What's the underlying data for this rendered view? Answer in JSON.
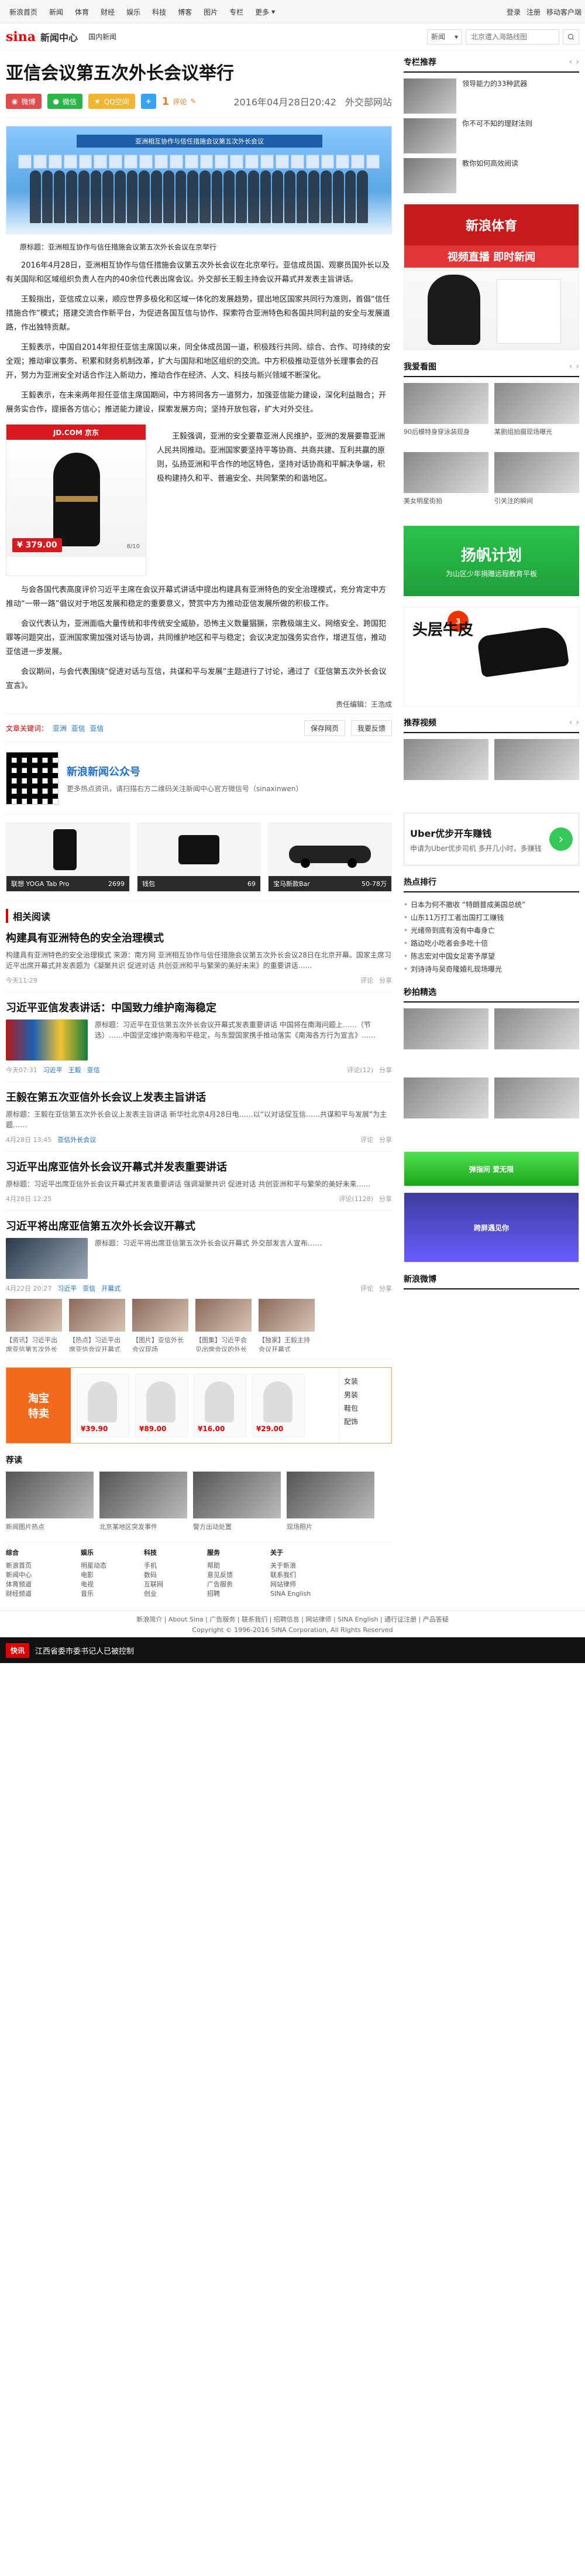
{
  "topbar": {
    "nav": [
      "新浪首页",
      "新闻",
      "体育",
      "财经",
      "娱乐",
      "科技",
      "博客",
      "图片",
      "专栏"
    ],
    "more": "更多",
    "right": [
      "登录",
      "注册",
      "移动客户端"
    ]
  },
  "header": {
    "logo_text": "sina",
    "section": "新闻中心",
    "breadcrumb": "国内新闻",
    "search": {
      "select_value": "新闻",
      "placeholder": "北京遭入海路线图"
    }
  },
  "article": {
    "title": "亚信会议第五次外长会议举行",
    "share": {
      "weibo": "微博",
      "weixin": "微信",
      "qzone": "QQ空间"
    },
    "comment_count": "1",
    "comment_label": "评论",
    "datetime": "2016年04月28日20:42",
    "source": "外交部网站",
    "hero_banner": "亚洲相互协作与信任措施会议第五次外长会议",
    "paragraphs": [
      "原标题：亚洲相互协作与信任措施会议第五次外长会议在京举行",
      "2016年4月28日，亚洲相互协作与信任措施会议第五次外长会议在北京举行。亚信成员国、观察员国外长以及有关国际和区域组织负责人在内的40余位代表出席会议。外交部长王毅主持会议开幕式并发表主旨讲话。",
      "王毅指出，亚信成立以来，顺应世界多极化和区域一体化的发展趋势，提出地区国家共同行为准则，首倡“信任措施合作”模式；搭建交流合作新平台，为促进各国互信与协作、探索符合亚洲特色和各国共同利益的安全与发展道路，作出独特贡献。",
      "王毅表示，中国自2014年担任亚信主席国以来，同全体成员国一道，积极践行共同、综合、合作、可持续的安全观；推动审议事务、积累和财务机制改革，扩大与国际和地区组织的交流。中方积极推动亚信外长理事会的召开，努力为亚洲安全对话合作注入新动力，推动合作在经济、人文、科技与新兴领域不断深化。",
      "王毅表示，在未来两年担任亚信主席国期间，中方将同各方一道努力，加强亚信能力建设，深化利益融合；开展务实合作，提振各方信心；推进能力建设，探索发展方向；坚持开放包容，扩大对外交往。",
      "王毅强调，亚洲的安全要靠亚洲人民维护，亚洲的发展要靠亚洲人民共同推动。亚洲国家要坚持平等协商、共商共建、互利共赢的原则，弘扬亚洲和平合作的地区特色，坚持对话协商和平解决争端，积极构建持久和平、普遍安全、共同繁荣的和谐地区。",
      "与会各国代表高度评价习近平主席在会议开幕式讲话中提出构建具有亚洲特色的安全治理模式，充分肯定中方推动“一带一路”倡议对于地区发展和稳定的重要意义，赞赏中方为推动亚信发展所做的积极工作。",
      "会议代表认为，亚洲面临大量传统和非传统安全威胁，恐怖主义数量猖獗，宗教极端主义、网络安全、跨国犯罪等问题突出，亚洲国家需加强对话与协调，共同维护地区和平与稳定；会议决定加强务实合作，增进互信，推动亚信进一步发展。",
      "会议期间，与会代表围绕“促进对话与互信，共谋和平与发展”主题进行了讨论，通过了《亚信第五次外长会议宣言》。"
    ],
    "ad_jd": {
      "store": "JD.COM 京东",
      "price": "¥ 379.00",
      "page": "8/10"
    },
    "editor": "责任编辑：王浩成",
    "keywords_label": "文章关键词：",
    "keywords": [
      "亚洲",
      "亚信",
      "亚信"
    ],
    "actions": [
      "保存网页",
      "我要反馈"
    ]
  },
  "wechat": {
    "title": "新浪新闻公众号",
    "desc": "更多热点资讯，请扫描右方二维码关注新闻中心官方微信号（sinaxinwen）"
  },
  "products": [
    {
      "name": "联想 YOGA Tab Pro",
      "price": "2699"
    },
    {
      "name": "钱包",
      "price": "69"
    },
    {
      "name": "宝马新款Bar",
      "price": "50-78万"
    }
  ],
  "related": {
    "title": "相关阅读",
    "items": [
      {
        "headline": "构建具有亚洲特色的安全治理模式",
        "desc": "构建具有亚洲特色的安全治理模式 来源：南方网 亚洲相互协作与信任措施会议第五次外长会议28日在北京开幕。国家主席习近平出席开幕式并发表题为《凝聚共识 促进对话 共创亚洲和平与繁荣的美好未来》的重要讲话……",
        "time": "今天11:29",
        "share": "分享",
        "comments": "评论"
      },
      {
        "headline": "习近平亚信发表讲话：中国致力维护南海稳定",
        "desc": "原标题：习近平在亚信第五次外长会议开幕式发表重要讲话 中国将在南海问题上……（节选）……中国坚定维护南海和平稳定，与东盟国家携手推动落实《南海各方行为宣言》……",
        "time": "今天07:31",
        "tags": [
          "习近平",
          "王毅",
          "亚信"
        ],
        "comments": "评论(12)",
        "share": "分享"
      },
      {
        "headline": "王毅在第五次亚信外长会议上发表主旨讲话",
        "desc": "原标题：王毅在亚信第五次外长会议上发表主旨讲话 新华社北京4月28日电……以“以对话促互信……共谋和平与发展”为主题……",
        "time": "4月28日 13:45",
        "tags": [
          "亚信外长会议"
        ],
        "comments": "评论",
        "share": "分享"
      },
      {
        "headline": "习近平出席亚信外长会议开幕式并发表重要讲话",
        "desc": "原标题：习近平出席亚信外长会议开幕式并发表重要讲话 强调凝聚共识 促进对话 共创亚洲和平与繁荣的美好未来……",
        "time": "4月28日 12:25",
        "comments": "评论(1128)",
        "share": "分享"
      },
      {
        "headline": "习近平将出席亚信第五次外长会议开幕式",
        "desc": "原标题：习近平将出席亚信第五次外长会议开幕式 外交部发言人宣布……",
        "time": "4月22日 20:27",
        "tags": [
          "习近平",
          "亚信",
          "开幕式"
        ],
        "comments": "评论",
        "share": "分享"
      }
    ],
    "gallery_caps": [
      "【资讯】习近平出席亚信第五次外长会议开幕式",
      "【热点】习近平出席亚信会议开幕式",
      "【图片】亚信外长会议现场",
      "【图集】习近平会见出席会议的外长",
      "【独家】王毅主持会议开幕式"
    ]
  },
  "mall": {
    "badge_line1": "淘宝",
    "badge_line2": "特卖",
    "items": [
      "¥39.90",
      "¥89.00",
      "¥16.00",
      "¥29.00"
    ],
    "menu": [
      "女装",
      "男装",
      "鞋包",
      "配饰"
    ]
  },
  "recommended_pics": {
    "title": "荐读",
    "caps": [
      "新闻图片热点",
      "北京某地区突发事件",
      "警方出动处置",
      "现场照片"
    ]
  },
  "footer": {
    "columns": [
      {
        "title": "综合",
        "lines": [
          "新浪首页",
          "新闻中心",
          "体育频道",
          "财经频道"
        ]
      },
      {
        "title": "娱乐",
        "lines": [
          "明星动态",
          "电影",
          "电视",
          "音乐"
        ]
      },
      {
        "title": "科技",
        "lines": [
          "手机",
          "数码",
          "互联网",
          "创业"
        ]
      },
      {
        "title": "服务",
        "lines": [
          "帮助",
          "意见反馈",
          "广告服务",
          "招聘"
        ]
      },
      {
        "title": "关于",
        "lines": [
          "关于新浪",
          "联系我们",
          "网站律师",
          "SINA English"
        ]
      }
    ],
    "bottom_links": "新浪简介 | About Sina | 广告服务 | 联系我们 | 招聘信息 | 网站律师 | SINA English | 通行证注册 | 产品答疑",
    "copyright": "Copyright © 1996-2016 SINA Corporation, All Rights Reserved"
  },
  "sidebar": {
    "editor_pick_title": "专栏推荐",
    "picks": [
      "领导能力的33种武器",
      "你不可不知的理财法则",
      "教你如何高效阅读"
    ],
    "sport_ad": {
      "top": "新浪体育",
      "live": "视频直播 即时新闻"
    },
    "image_title": "我爱看图",
    "images": [
      "90后模特身穿泳装现身",
      "某剧组拍摄现场曝光",
      "美女明星街拍",
      "引关注的瞬间"
    ],
    "green_ad": {
      "big": "扬帆计划",
      "sm": "为山区少年捐赠远程教育平板"
    },
    "shop_ad": {
      "big": "头层牛皮",
      "tag": "3"
    },
    "video_title": "推荐视频",
    "uber": {
      "t": "Uber优步开车赚钱",
      "s": "申请为Uber优步司机 多开几小时，多赚钱"
    },
    "hot_title": "热点排行",
    "hot": [
      "日本为何不撤收 “特朗普成美国总统”",
      "山东11万打工者出国打工赚钱",
      "光绪帝到底有没有中毒身亡",
      "路边吃小吃者会多吃十倍",
      "陈志宏对中国女足寄予厚望",
      "刘诗诗与吴奇隆婚礼现场曝光"
    ],
    "second_title": "秒拍精选",
    "apps": [
      "弹指间 爱无限",
      "跨屏遇见你"
    ],
    "weibo_title": "新浪微博"
  },
  "fixed_bar": {
    "badge": "快讯",
    "msg": "江西省委市委书记人已被控制"
  }
}
